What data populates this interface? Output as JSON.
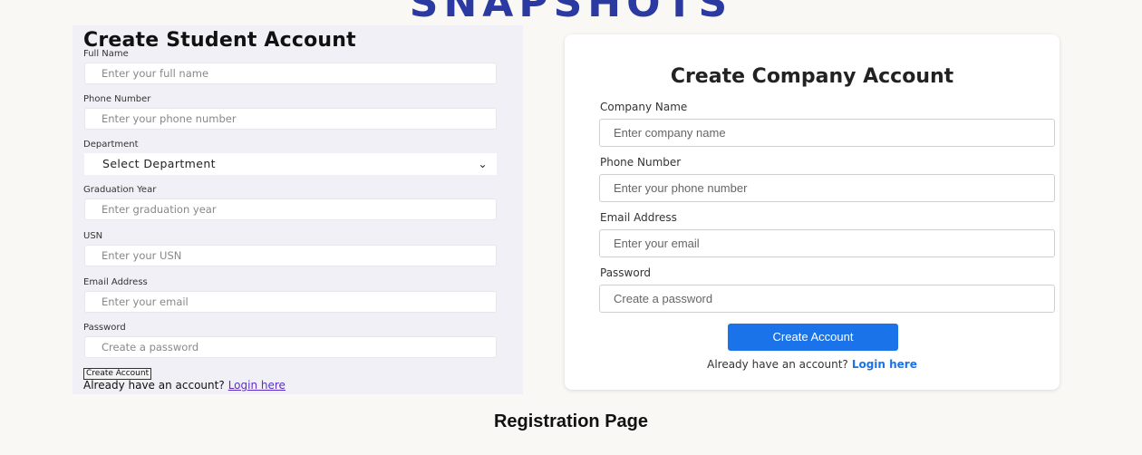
{
  "top_heading_partial": "SNAPSHOTS",
  "student": {
    "title": "Create Student Account",
    "full_name_label": "Full Name",
    "full_name_placeholder": "Enter your full name",
    "phone_label": "Phone Number",
    "phone_placeholder": "Enter your phone number",
    "department_label": "Department",
    "department_selected": "Select Department",
    "grad_year_label": "Graduation Year",
    "grad_year_placeholder": "Enter graduation year",
    "usn_label": "USN",
    "usn_placeholder": "Enter your USN",
    "email_label": "Email Address",
    "email_placeholder": "Enter your email",
    "password_label": "Password",
    "password_placeholder": "Create a password",
    "submit_label": "Create Account",
    "login_prompt": "Already have an account?",
    "login_link": "Login here"
  },
  "company": {
    "title": "Create Company Account",
    "company_name_label": "Company Name",
    "company_name_placeholder": "Enter company name",
    "phone_label": "Phone Number",
    "phone_placeholder": "Enter your phone number",
    "email_label": "Email Address",
    "email_placeholder": "Enter your email",
    "password_label": "Password",
    "password_placeholder": "Create a password",
    "submit_label": "Create Account",
    "login_prompt": "Already have an account?",
    "login_link": "Login here"
  },
  "caption": "Registration Page",
  "colors": {
    "accent": "#1a73e8",
    "student_link": "#5b2fc6",
    "heading_partial": "#2a3aa0"
  }
}
